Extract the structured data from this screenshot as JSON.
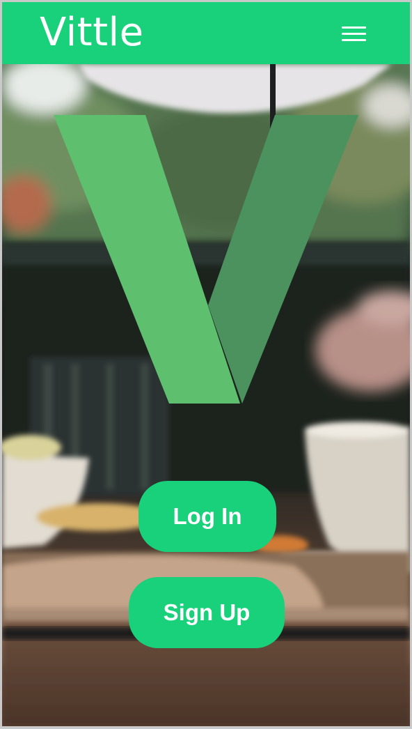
{
  "header": {
    "brand": "Vittle",
    "menu_icon": "hamburger-menu-icon"
  },
  "hero": {
    "logo_icon": "vittle-v-logo"
  },
  "actions": {
    "login_label": "Log In",
    "signup_label": "Sign Up"
  },
  "colors": {
    "accent": "#19d17b",
    "logo_light": "#5ebf6f",
    "logo_dark": "#4b925f"
  }
}
